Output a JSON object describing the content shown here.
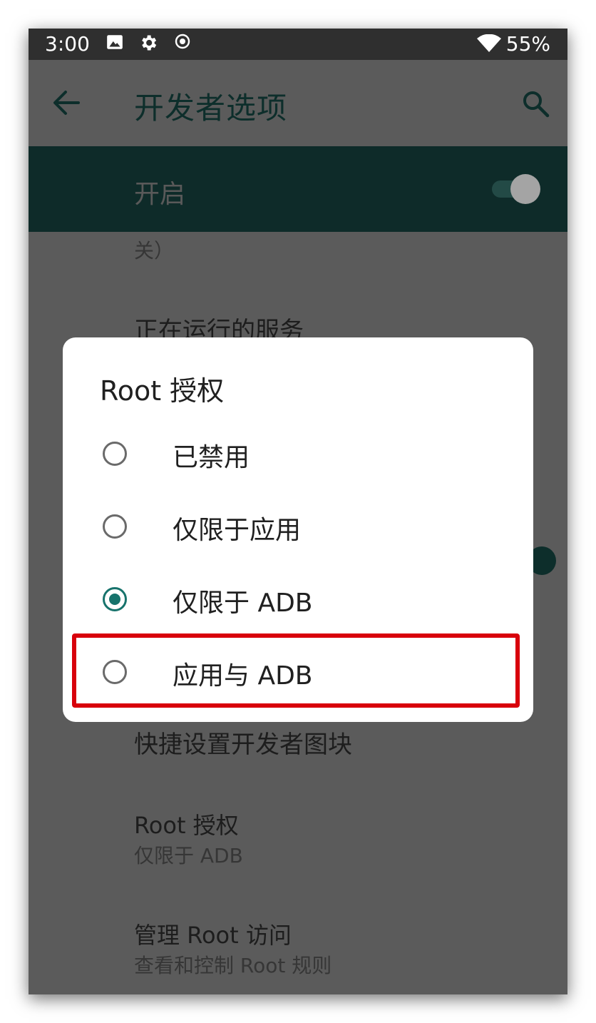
{
  "status_bar": {
    "time": "3:00",
    "icons": [
      "image-icon",
      "gear-icon",
      "record-icon",
      "wifi-icon"
    ],
    "battery": "55%"
  },
  "app_bar": {
    "title": "开发者选项",
    "back_icon": "arrow-left-icon",
    "search_icon": "search-icon"
  },
  "main_switch": {
    "label": "开启",
    "on": true
  },
  "background_list": {
    "partial_summary": "关）",
    "items": [
      {
        "title": "正在运行的服务"
      },
      {
        "title": "快捷设置开发者图块"
      },
      {
        "title": "Root 授权",
        "summary": "仅限于 ADB"
      },
      {
        "title": "管理 Root 访问",
        "summary": "查看和控制 Root 规则"
      }
    ]
  },
  "dialog": {
    "title": "Root 授权",
    "options": [
      {
        "label": "已禁用",
        "selected": false
      },
      {
        "label": "仅限于应用",
        "selected": false
      },
      {
        "label": "仅限于 ADB",
        "selected": true
      },
      {
        "label": "应用与 ADB",
        "selected": false,
        "highlighted": true
      }
    ]
  },
  "colors": {
    "accent": "#17736c",
    "highlight_border": "#d8000c",
    "scrim": "#5b5b5b",
    "status_bar": "#2f2f2f"
  }
}
